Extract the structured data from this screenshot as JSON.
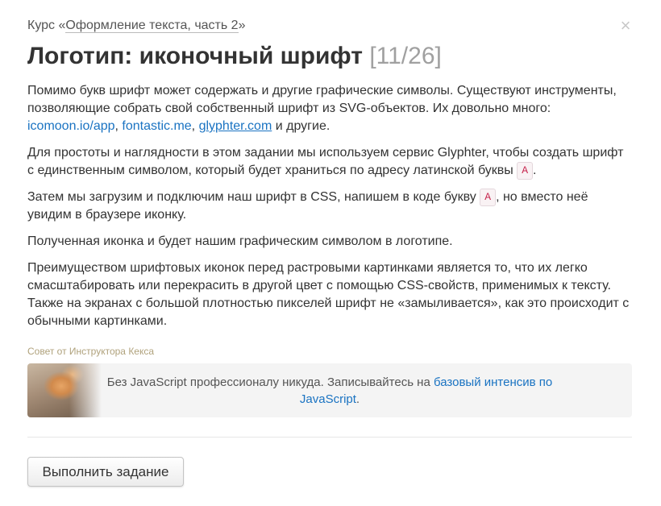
{
  "header": {
    "course_prefix": "Курс «",
    "course_name": "Оформление текста, часть 2",
    "course_suffix": "»",
    "close_symbol": "×"
  },
  "title": {
    "text": "Логотип: иконочный шрифт",
    "counter": "[11/26]"
  },
  "paragraphs": {
    "p1": {
      "text": "Помимо букв шрифт может содержать и другие графические символы. Существуют инструменты, позволяющие собрать свой собственный шрифт из SVG-объектов. Их довольно много: ",
      "link1": "icomoon.io/app",
      "sep1": ", ",
      "link2": "fontastic.me",
      "sep2": ", ",
      "link3": "glyphter.com",
      "tail": " и другие."
    },
    "p2": {
      "text": "Для простоты и наглядности в этом задании мы используем сервис Glyphter, чтобы создать шрифт с единственным символом, который будет храниться по адресу латинской буквы ",
      "code": "A",
      "tail": "."
    },
    "p3": {
      "text": "Затем мы загрузим и подключим наш шрифт в CSS, напишем в коде букву ",
      "code": "A",
      "tail": ", но вместо неё увидим в браузере иконку."
    },
    "p4": {
      "text": "Полученная иконка и будет нашим графическим символом в логотипе."
    },
    "p5": {
      "text": "Преимуществом шрифтовых иконок перед растровыми картинками является то, что их легко смасштабировать или перекрасить в другой цвет с помощью CSS-свойств, применимых к тексту. Также на экранах с большой плотностью пикселей шрифт не «замыливается», как это происходит с обычными картинками."
    }
  },
  "tip": {
    "label": "Совет от Инструктора Кекса",
    "text": "Без JavaScript профессионалу никуда. Записывайтесь на ",
    "link": "базовый интенсив по JavaScript",
    "tail": "."
  },
  "actions": {
    "submit_label": "Выполнить задание"
  },
  "colors": {
    "link": "#1a73c2",
    "code_text": "#c7254e",
    "tip_label": "#b0a27c",
    "counter": "#a0a0a0"
  }
}
